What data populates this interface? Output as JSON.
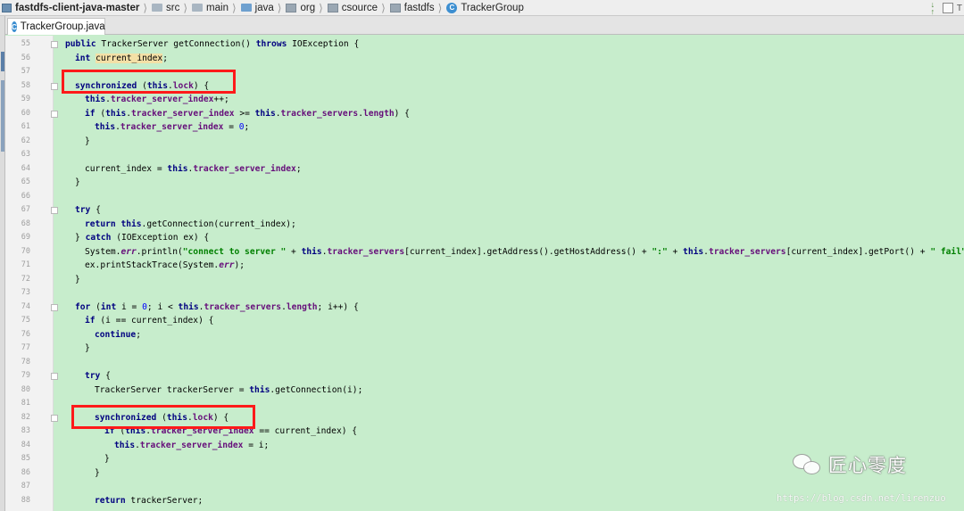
{
  "breadcrumb": {
    "items": [
      {
        "label": "fastdfs-client-java-master",
        "icon": "module-icon"
      },
      {
        "label": "src",
        "icon": "folder-icon"
      },
      {
        "label": "main",
        "icon": "folder-icon"
      },
      {
        "label": "java",
        "icon": "source-folder-icon"
      },
      {
        "label": "org",
        "icon": "package-icon"
      },
      {
        "label": "csource",
        "icon": "package-icon"
      },
      {
        "label": "fastdfs",
        "icon": "package-icon"
      },
      {
        "label": "TrackerGroup",
        "icon": "class-icon"
      }
    ],
    "right_text": "T"
  },
  "tab": {
    "label": "TrackerGroup.java",
    "icon": "class-icon"
  },
  "gutter": {
    "line_numbers": [
      "55",
      "56",
      "57",
      "58",
      "59",
      "60",
      "61",
      "62",
      "63",
      "64",
      "65",
      "66",
      "67",
      "68",
      "69",
      "70",
      "71",
      "72",
      "73",
      "74",
      "75",
      "76",
      "77",
      "78",
      "79",
      "80",
      "81",
      "82",
      "83",
      "84",
      "85",
      "86",
      "87",
      "88"
    ]
  },
  "editor": {
    "lines": [
      {
        "n": "55",
        "indent": 1,
        "tokens": [
          [
            "kw",
            "public"
          ],
          [
            "pl",
            " TrackerServer getConnection() "
          ],
          [
            "kw",
            "throws"
          ],
          [
            "pl",
            " IOException {"
          ]
        ]
      },
      {
        "n": "56",
        "indent": 2,
        "tokens": [
          [
            "kw",
            "int"
          ],
          [
            "pl",
            " "
          ],
          [
            "hl",
            "current_index"
          ],
          [
            "pl",
            ";"
          ]
        ]
      },
      {
        "n": "57",
        "indent": 0,
        "tokens": []
      },
      {
        "n": "58",
        "indent": 2,
        "tokens": [
          [
            "kw",
            "synchronized"
          ],
          [
            "pl",
            " ("
          ],
          [
            "kw",
            "this"
          ],
          [
            "pl",
            "."
          ],
          [
            "fld",
            "lock"
          ],
          [
            "pl",
            ") {"
          ]
        ]
      },
      {
        "n": "59",
        "indent": 3,
        "tokens": [
          [
            "kw",
            "this"
          ],
          [
            "pl",
            "."
          ],
          [
            "fld",
            "tracker_server_index"
          ],
          [
            "pl",
            "++;"
          ]
        ]
      },
      {
        "n": "60",
        "indent": 3,
        "tokens": [
          [
            "kw",
            "if"
          ],
          [
            "pl",
            " ("
          ],
          [
            "kw",
            "this"
          ],
          [
            "pl",
            "."
          ],
          [
            "fld",
            "tracker_server_index"
          ],
          [
            "pl",
            " >= "
          ],
          [
            "kw",
            "this"
          ],
          [
            "pl",
            "."
          ],
          [
            "fld",
            "tracker_servers"
          ],
          [
            "pl",
            "."
          ],
          [
            "fld",
            "length"
          ],
          [
            "pl",
            ") {"
          ]
        ]
      },
      {
        "n": "61",
        "indent": 4,
        "tokens": [
          [
            "kw",
            "this"
          ],
          [
            "pl",
            "."
          ],
          [
            "fld",
            "tracker_server_index"
          ],
          [
            "pl",
            " = "
          ],
          [
            "num",
            "0"
          ],
          [
            "pl",
            ";"
          ]
        ]
      },
      {
        "n": "62",
        "indent": 3,
        "tokens": [
          [
            "pl",
            "}"
          ]
        ]
      },
      {
        "n": "63",
        "indent": 0,
        "tokens": []
      },
      {
        "n": "64",
        "indent": 3,
        "tokens": [
          [
            "pl",
            "current_index = "
          ],
          [
            "kw",
            "this"
          ],
          [
            "pl",
            "."
          ],
          [
            "fld",
            "tracker_server_index"
          ],
          [
            "pl",
            ";"
          ]
        ]
      },
      {
        "n": "65",
        "indent": 2,
        "tokens": [
          [
            "pl",
            "}"
          ]
        ]
      },
      {
        "n": "66",
        "indent": 0,
        "tokens": []
      },
      {
        "n": "67",
        "indent": 2,
        "tokens": [
          [
            "kw",
            "try"
          ],
          [
            "pl",
            " {"
          ]
        ]
      },
      {
        "n": "68",
        "indent": 3,
        "tokens": [
          [
            "kw",
            "return"
          ],
          [
            "pl",
            " "
          ],
          [
            "kw",
            "this"
          ],
          [
            "pl",
            ".getConnection(current_index);"
          ]
        ]
      },
      {
        "n": "69",
        "indent": 2,
        "tokens": [
          [
            "pl",
            "} "
          ],
          [
            "kw",
            "catch"
          ],
          [
            "pl",
            " (IOException ex) {"
          ]
        ]
      },
      {
        "n": "70",
        "indent": 3,
        "tokens": [
          [
            "pl",
            "System."
          ],
          [
            "sta",
            "err"
          ],
          [
            "pl",
            ".println("
          ],
          [
            "str",
            "\"connect to server \""
          ],
          [
            "pl",
            " + "
          ],
          [
            "kw",
            "this"
          ],
          [
            "pl",
            "."
          ],
          [
            "fld",
            "tracker_servers"
          ],
          [
            "pl",
            "[current_index].getAddress().getHostAddress() + "
          ],
          [
            "str",
            "\":\""
          ],
          [
            "pl",
            " + "
          ],
          [
            "kw",
            "this"
          ],
          [
            "pl",
            "."
          ],
          [
            "fld",
            "tracker_servers"
          ],
          [
            "pl",
            "[current_index].getPort() + "
          ],
          [
            "str",
            "\" fail\""
          ],
          [
            "pl",
            ");"
          ]
        ]
      },
      {
        "n": "71",
        "indent": 3,
        "tokens": [
          [
            "pl",
            "ex.printStackTrace(System."
          ],
          [
            "sta",
            "err"
          ],
          [
            "pl",
            ");"
          ]
        ]
      },
      {
        "n": "72",
        "indent": 2,
        "tokens": [
          [
            "pl",
            "}"
          ]
        ]
      },
      {
        "n": "73",
        "indent": 0,
        "tokens": []
      },
      {
        "n": "74",
        "indent": 2,
        "tokens": [
          [
            "kw",
            "for"
          ],
          [
            "pl",
            " ("
          ],
          [
            "kw",
            "int"
          ],
          [
            "pl",
            " i = "
          ],
          [
            "num",
            "0"
          ],
          [
            "pl",
            "; i < "
          ],
          [
            "kw",
            "this"
          ],
          [
            "pl",
            "."
          ],
          [
            "fld",
            "tracker_servers"
          ],
          [
            "pl",
            "."
          ],
          [
            "fld",
            "length"
          ],
          [
            "pl",
            "; i++) {"
          ]
        ]
      },
      {
        "n": "75",
        "indent": 3,
        "tokens": [
          [
            "kw",
            "if"
          ],
          [
            "pl",
            " (i == current_index) {"
          ]
        ]
      },
      {
        "n": "76",
        "indent": 4,
        "tokens": [
          [
            "kw",
            "continue"
          ],
          [
            "pl",
            ";"
          ]
        ]
      },
      {
        "n": "77",
        "indent": 3,
        "tokens": [
          [
            "pl",
            "}"
          ]
        ]
      },
      {
        "n": "78",
        "indent": 0,
        "tokens": []
      },
      {
        "n": "79",
        "indent": 3,
        "tokens": [
          [
            "kw",
            "try"
          ],
          [
            "pl",
            " {"
          ]
        ]
      },
      {
        "n": "80",
        "indent": 4,
        "tokens": [
          [
            "pl",
            "TrackerServer trackerServer = "
          ],
          [
            "kw",
            "this"
          ],
          [
            "pl",
            ".getConnection(i);"
          ]
        ]
      },
      {
        "n": "81",
        "indent": 0,
        "tokens": []
      },
      {
        "n": "82",
        "indent": 4,
        "tokens": [
          [
            "kw",
            "synchronized"
          ],
          [
            "pl",
            " ("
          ],
          [
            "kw",
            "this"
          ],
          [
            "pl",
            "."
          ],
          [
            "fld",
            "lock"
          ],
          [
            "pl",
            ") {"
          ]
        ]
      },
      {
        "n": "83",
        "indent": 5,
        "tokens": [
          [
            "kw",
            "if"
          ],
          [
            "pl",
            " ("
          ],
          [
            "kw",
            "this"
          ],
          [
            "pl",
            "."
          ],
          [
            "fld",
            "tracker_server_index"
          ],
          [
            "pl",
            " == current_index) {"
          ]
        ]
      },
      {
        "n": "84",
        "indent": 6,
        "tokens": [
          [
            "kw",
            "this"
          ],
          [
            "pl",
            "."
          ],
          [
            "fld",
            "tracker_server_index"
          ],
          [
            "pl",
            " = i;"
          ]
        ]
      },
      {
        "n": "85",
        "indent": 5,
        "tokens": [
          [
            "pl",
            "}"
          ]
        ]
      },
      {
        "n": "86",
        "indent": 4,
        "tokens": [
          [
            "pl",
            "}"
          ]
        ]
      },
      {
        "n": "87",
        "indent": 0,
        "tokens": []
      },
      {
        "n": "88",
        "indent": 4,
        "tokens": [
          [
            "kw",
            "return"
          ],
          [
            "pl",
            " trackerServer;"
          ]
        ]
      }
    ]
  },
  "watermark": {
    "account_name": "匠心零度",
    "source_url": "https://blog.csdn.net/lirenzuo"
  },
  "colors": {
    "editor_background": "#c7edcc",
    "keyword": "#000080",
    "field": "#660e7a",
    "string": "#008000",
    "number": "#0000ff",
    "annotation_box": "#ff1a1a"
  }
}
